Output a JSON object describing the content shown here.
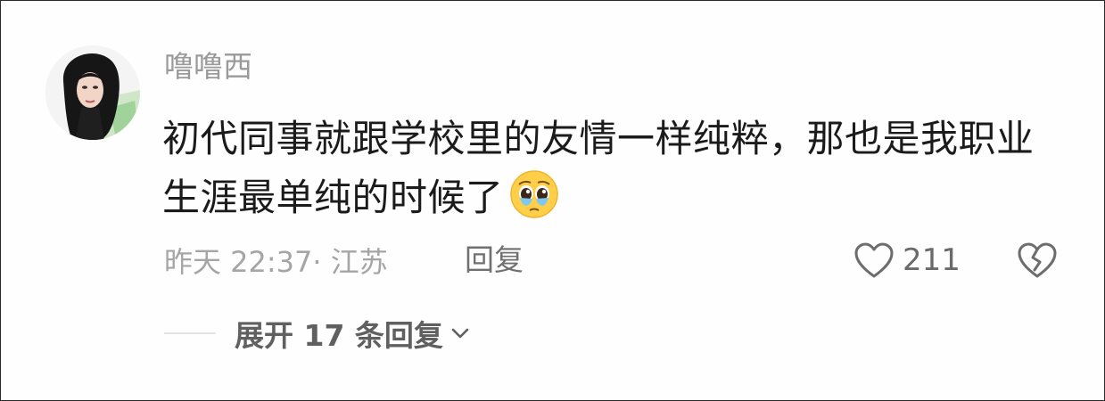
{
  "comment": {
    "username": "噜噜西",
    "text_line1": "初代同事就跟学校里的友情一样纯粹，那也是我职业",
    "text_line2": "生涯最单纯的时候了",
    "emoji": "pleading-face-with-tears",
    "meta": "昨天 22:37· 江苏",
    "reply_label": "回复",
    "like_count": "211",
    "expand_label": "展开 17 条回复"
  },
  "icons": {
    "like": "heart-outline-icon",
    "dislike": "broken-heart-outline-icon",
    "expand": "chevron-down-icon"
  },
  "colors": {
    "username": "#9a9a9a",
    "body_text": "#1b1b1b",
    "meta_text": "#a5a5a5",
    "action_text": "#707070"
  }
}
